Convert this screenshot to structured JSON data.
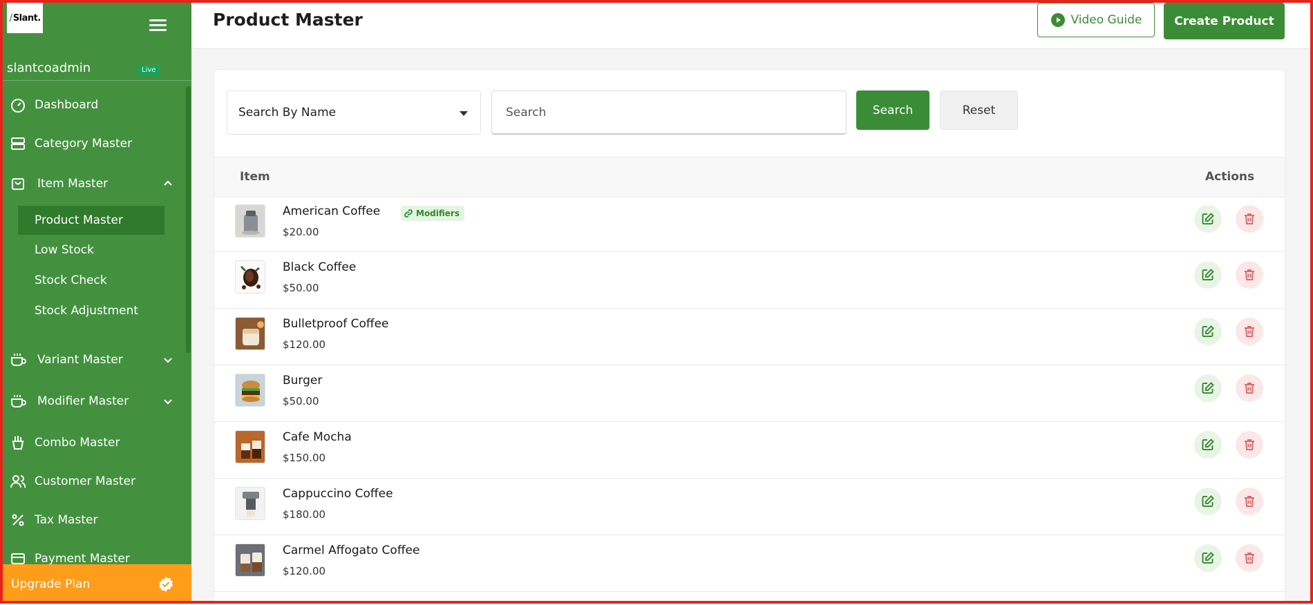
{
  "sidebar": {
    "logo_text": "Slant.",
    "username": "slantcoadmin",
    "env_badge": "Live",
    "items": [
      {
        "label": "Dashboard",
        "icon": "gauge-icon"
      },
      {
        "label": "Category Master",
        "icon": "server-icon"
      },
      {
        "label": "Item Master",
        "icon": "bag-icon"
      },
      {
        "label": "Variant Master",
        "icon": "cup-icon"
      },
      {
        "label": "Modifier Master",
        "icon": "cup-icon"
      },
      {
        "label": "Combo Master",
        "icon": "fries-icon"
      },
      {
        "label": "Customer Master",
        "icon": "users-icon"
      },
      {
        "label": "Tax Master",
        "icon": "percent-icon"
      },
      {
        "label": "Payment Master",
        "icon": "card-icon"
      }
    ],
    "sub_items": [
      "Product Master",
      "Low Stock",
      "Stock Check",
      "Stock Adjustment"
    ],
    "upgrade_label": "Upgrade Plan"
  },
  "header": {
    "title": "Product Master",
    "video_guide_label": "Video Guide",
    "create_label": "Create Product"
  },
  "filters": {
    "search_by": "Search By Name",
    "search_placeholder": "Search",
    "search_label": "Search",
    "reset_label": "Reset"
  },
  "table": {
    "col_item": "Item",
    "col_actions": "Actions",
    "modifier_badge": "Modifiers",
    "rows": [
      {
        "name": "American Coffee",
        "price": "$20.00",
        "has_modifiers": true
      },
      {
        "name": "Black Coffee",
        "price": "$50.00",
        "has_modifiers": false
      },
      {
        "name": "Bulletproof Coffee",
        "price": "$120.00",
        "has_modifiers": false
      },
      {
        "name": "Burger",
        "price": "$50.00",
        "has_modifiers": false
      },
      {
        "name": "Cafe Mocha",
        "price": "$150.00",
        "has_modifiers": false
      },
      {
        "name": "Cappuccino Coffee",
        "price": "$180.00",
        "has_modifiers": false
      },
      {
        "name": "Carmel Affogato Coffee",
        "price": "$120.00",
        "has_modifiers": false
      }
    ]
  },
  "colors": {
    "brand_green": "#43913f",
    "accent_green": "#3b8c36",
    "upgrade_orange": "#ff9c1a",
    "delete_red": "#e06b6b"
  }
}
